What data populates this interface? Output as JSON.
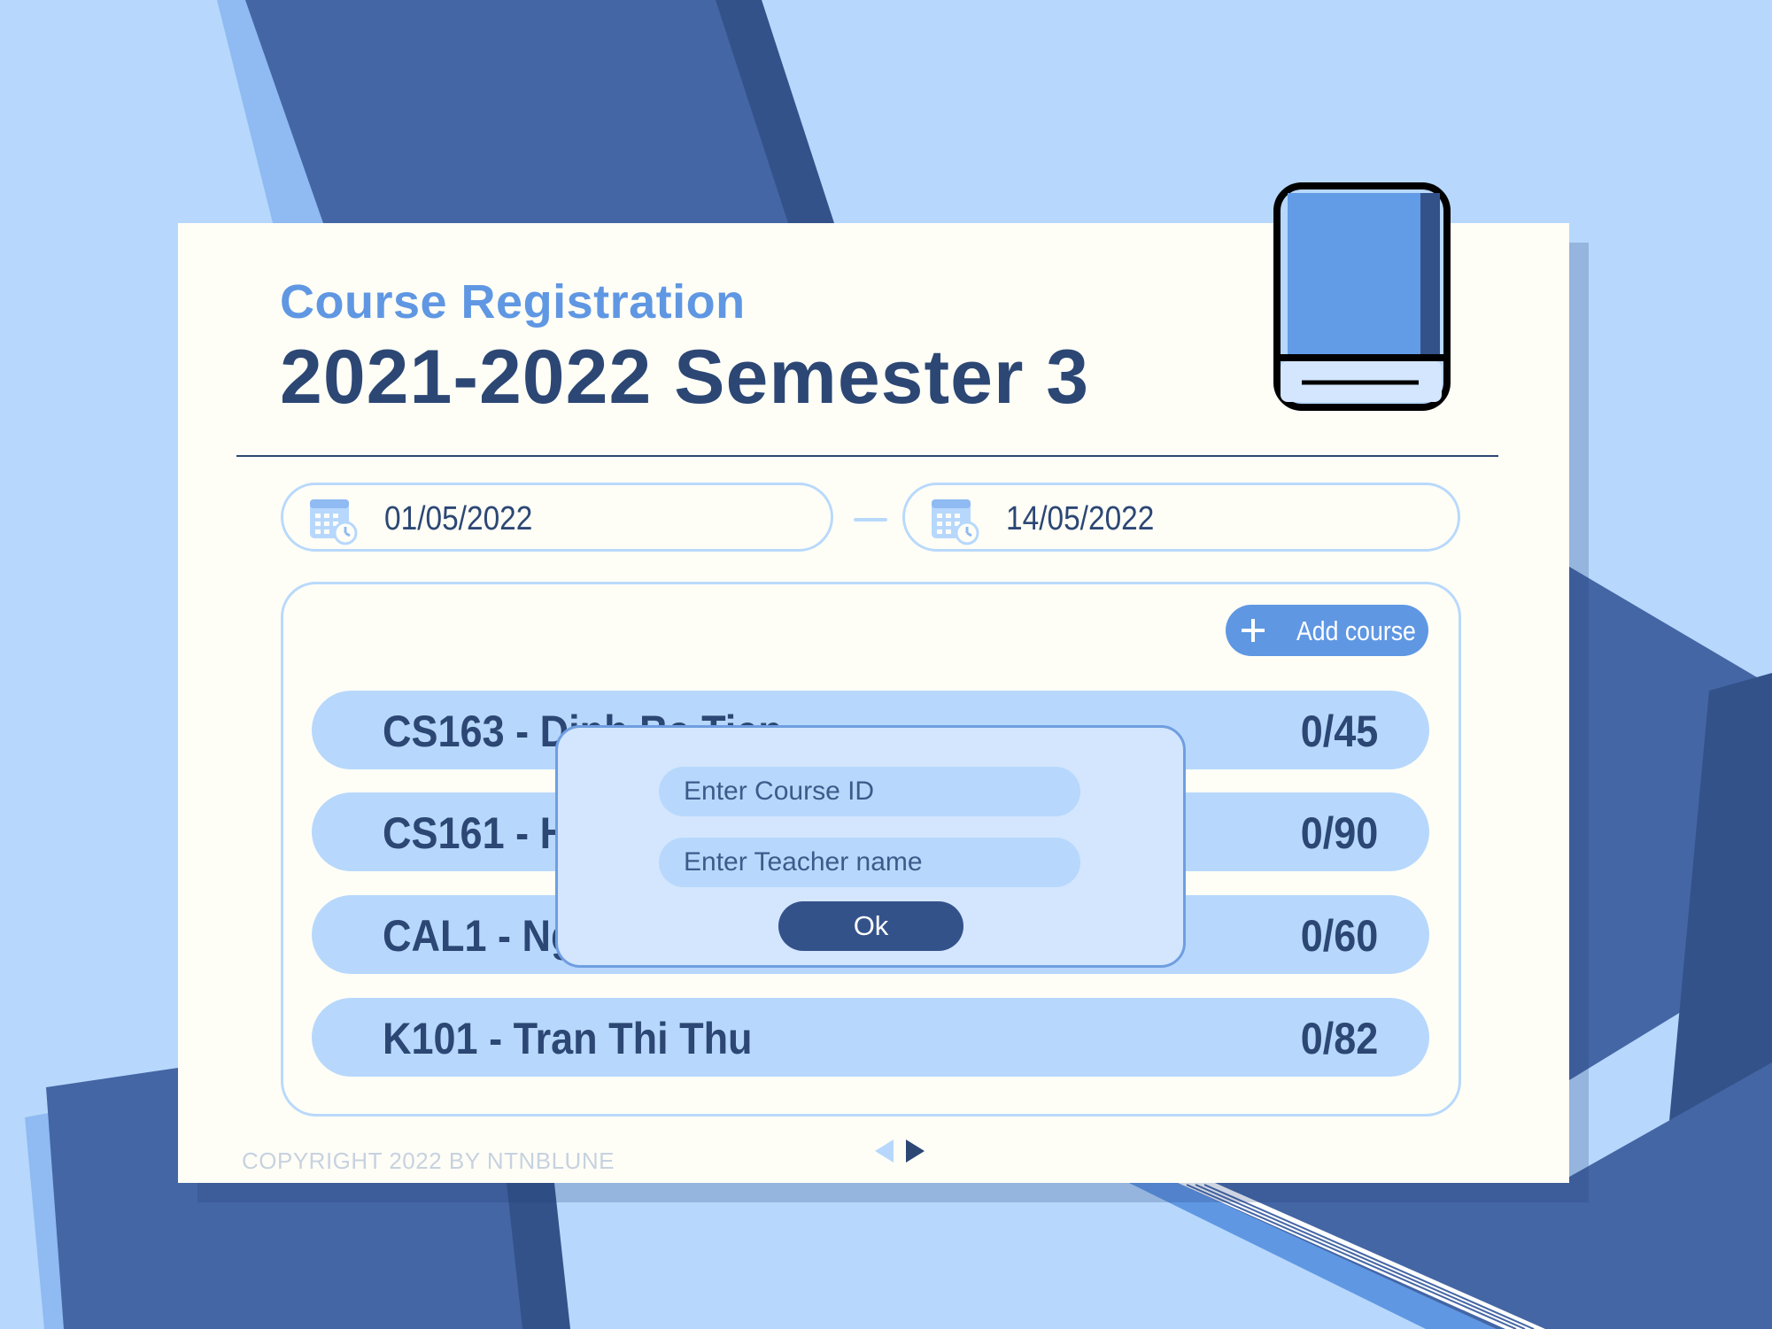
{
  "header": {
    "subtitle": "Course Registration",
    "title": "2021-2022 Semester 3"
  },
  "dates": {
    "start": "01/05/2022",
    "end": "14/05/2022"
  },
  "add_course": {
    "label": "Add course"
  },
  "courses": [
    {
      "name": "CS163 - Dinh Ba Tien",
      "count": "0/45"
    },
    {
      "name": "CS161 - H",
      "count": "0/90"
    },
    {
      "name": "CAL1 - Ng",
      "count": "0/60"
    },
    {
      "name": "K101 - Tran Thi Thu",
      "count": "0/82"
    }
  ],
  "dialog": {
    "course_id_placeholder": "Enter Course ID",
    "teacher_placeholder": "Enter Teacher name",
    "ok_label": "Ok"
  },
  "footer": {
    "copyright": "COPYRIGHT 2022 BY NTNBLUNE"
  },
  "icons": {
    "book": "book-icon",
    "calendar": "calendar-clock-icon",
    "plus": "plus-icon",
    "prev": "arrow-left-icon",
    "next": "arrow-right-icon"
  },
  "colors": {
    "background": "#b7d8fc",
    "card": "#fefef7",
    "accent": "#5f97e3",
    "navy": "#2c4774",
    "row": "#b7d8fc",
    "dialog": "#d3e6fe",
    "button_dark": "#34528a"
  }
}
